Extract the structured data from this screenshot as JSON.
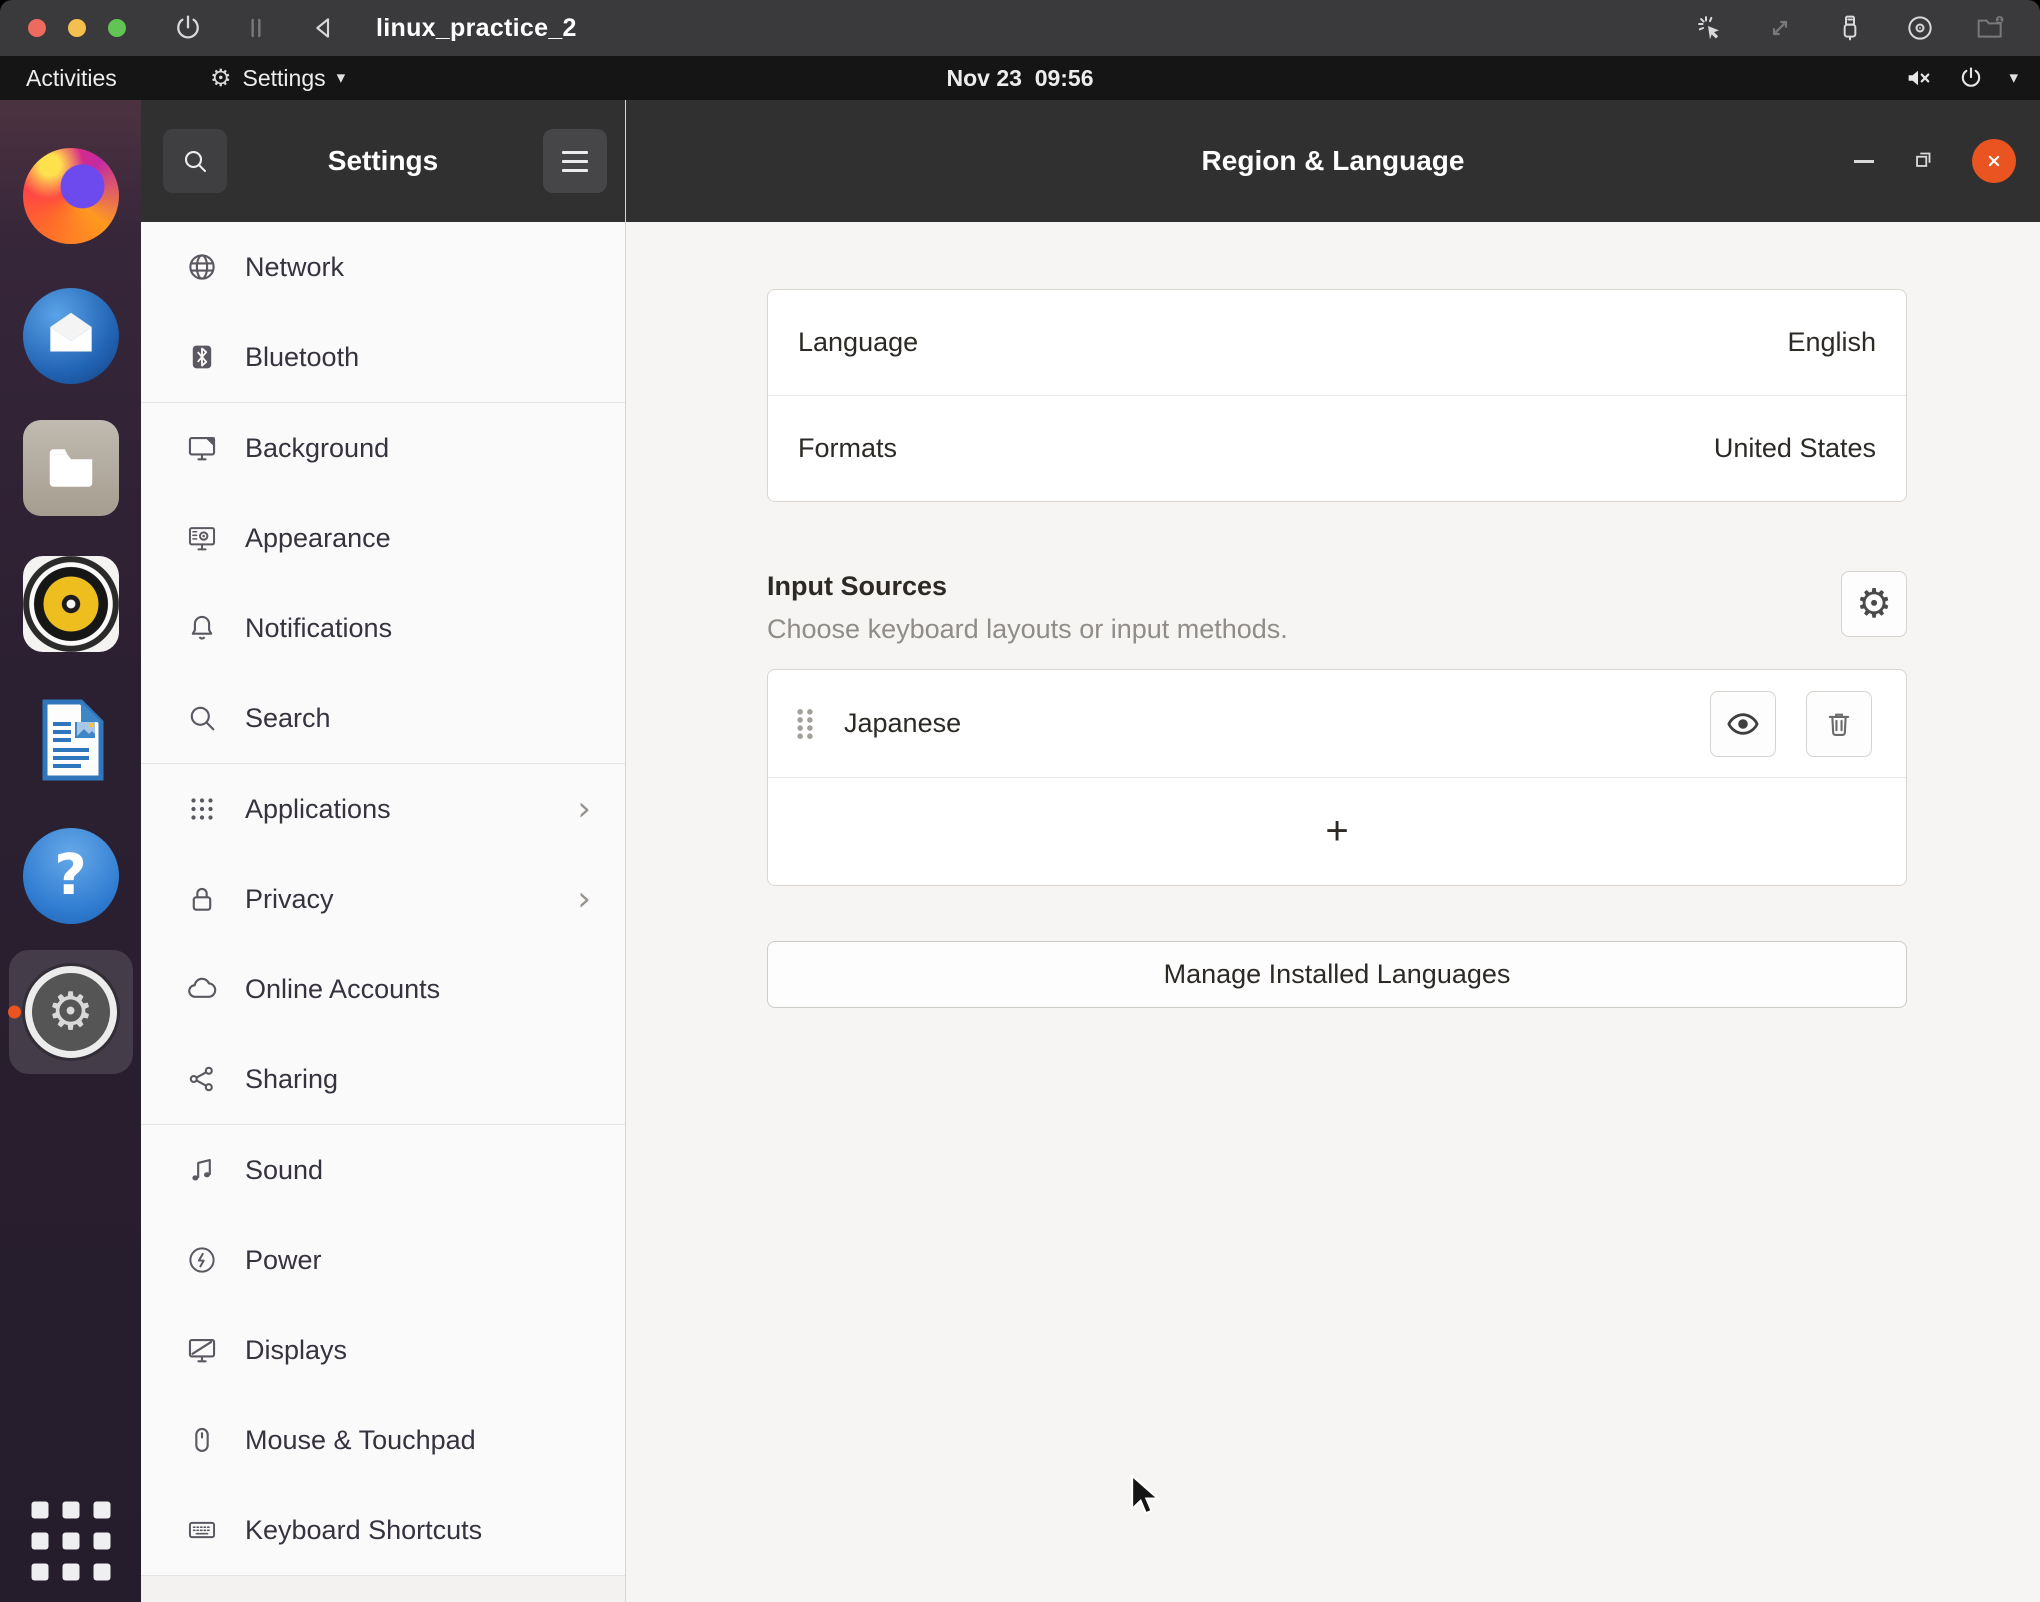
{
  "vm_titlebar": {
    "title": "linux_practice_2"
  },
  "top_bar": {
    "activities_label": "Activities",
    "app_menu_label": "Settings",
    "clock": "Nov 23  09:56"
  },
  "icons": {
    "gear": "⚙",
    "caret_down": "▾"
  },
  "dock": {
    "items": [
      {
        "name": "Firefox"
      },
      {
        "name": "Thunderbird"
      },
      {
        "name": "Files"
      },
      {
        "name": "Rhythmbox"
      },
      {
        "name": "LibreOffice Writer"
      },
      {
        "name": "Help"
      },
      {
        "name": "Settings",
        "active": true
      },
      {
        "name": "Show Applications"
      }
    ],
    "help_glyph": "?",
    "indicator_color": "#E95420"
  },
  "sidebar": {
    "title": "Settings",
    "items": [
      {
        "label": "Network"
      },
      {
        "label": "Bluetooth"
      },
      {
        "label": "Background"
      },
      {
        "label": "Appearance"
      },
      {
        "label": "Notifications"
      },
      {
        "label": "Search"
      },
      {
        "label": "Applications",
        "chevron": "›"
      },
      {
        "label": "Privacy",
        "chevron": "›"
      },
      {
        "label": "Online Accounts"
      },
      {
        "label": "Sharing"
      },
      {
        "label": "Sound"
      },
      {
        "label": "Power"
      },
      {
        "label": "Displays"
      },
      {
        "label": "Mouse & Touchpad"
      },
      {
        "label": "Keyboard Shortcuts"
      }
    ]
  },
  "main": {
    "title": "Region & Language",
    "rows": [
      {
        "label": "Language",
        "value": "English"
      },
      {
        "label": "Formats",
        "value": "United States"
      }
    ],
    "input_sources": {
      "title": "Input Sources",
      "subtitle": "Choose keyboard layouts or input methods.",
      "sources": [
        {
          "name": "Japanese"
        }
      ],
      "add_label": "+"
    },
    "manage_button_label": "Manage Installed Languages"
  },
  "colors": {
    "accent_orange": "#E95420",
    "headerbar": "#303030",
    "topbar": "#151515",
    "vm_titlebar": "#3A3A3C",
    "content_bg": "#F6F5F4",
    "sidebar_bg": "#FBFAFA"
  }
}
